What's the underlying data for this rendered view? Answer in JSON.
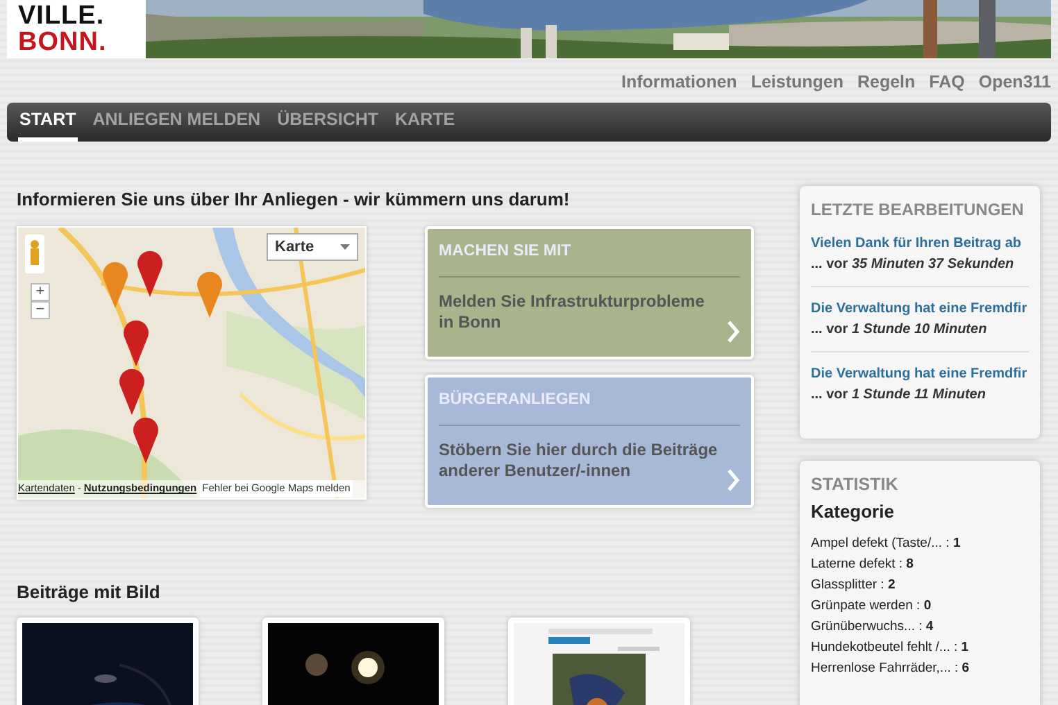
{
  "logo": {
    "lines": [
      "VILLE.",
      "BONN."
    ]
  },
  "top_links": [
    "Informationen",
    "Leistungen",
    "Regeln",
    "FAQ",
    "Open311"
  ],
  "nav": [
    {
      "label": "START",
      "selected": true
    },
    {
      "label": "ANLIEGEN MELDEN",
      "selected": false
    },
    {
      "label": "ÜBERSICHT",
      "selected": false
    },
    {
      "label": "KARTE",
      "selected": false
    }
  ],
  "intro": {
    "heading": "Informieren Sie uns über Ihr Anliegen - wir kümmern uns darum!",
    "map": {
      "kind": "picture",
      "map_type": "Karte",
      "zoom_in": "+",
      "zoom_out": "−",
      "map_data_link": "Kartendaten",
      "separator": "-",
      "terms_link": "Nutzungsbedingungen",
      "report_link": "Fehler bei Google Maps melden"
    },
    "tiles": [
      {
        "title": "MACHEN SIE MIT",
        "text": "Melden Sie Infrastrukturprobleme in Bonn",
        "color": "#a9b48c"
      },
      {
        "title": "BÜRGERANLIEGEN",
        "text": "Stöbern Sie hier durch die Beiträge anderer Benutzer/-innen",
        "color": "#a7b9d6"
      }
    ]
  },
  "recent": {
    "title": "LETZTE BEARBEITUNGEN",
    "items": [
      {
        "link": "Vielen Dank für Ihren Beitrag ab",
        "rest": "... vor *35 Minuten 37 Sekunden*"
      },
      {
        "link": "Die Verwaltung hat eine Fremdfir",
        "rest": "... vor *1 Stunde 10 Minuten*"
      },
      {
        "link": "Die Verwaltung hat eine Fremdfir",
        "rest": "... vor *1 Stunde 11 Minuten*"
      }
    ]
  },
  "stats": {
    "title": "STATISTIK",
    "subtitle": "Kategorie",
    "rows": [
      "Ampel defekt (Taste/... : **1**",
      "Laterne defekt : **8**",
      "Glassplitter : **2**",
      "Grünpate werden : **0**",
      "Grünüberwuchs... : **4**",
      "Hundekotbeutel fehlt /... : **1**",
      "Herrenlose Fahrräder,... : **6**"
    ]
  },
  "gallery": {
    "heading": "Beiträge mit Bild",
    "photos": [
      {
        "kind": "night"
      },
      {
        "kind": "moon"
      },
      {
        "kind": "screen"
      }
    ]
  }
}
